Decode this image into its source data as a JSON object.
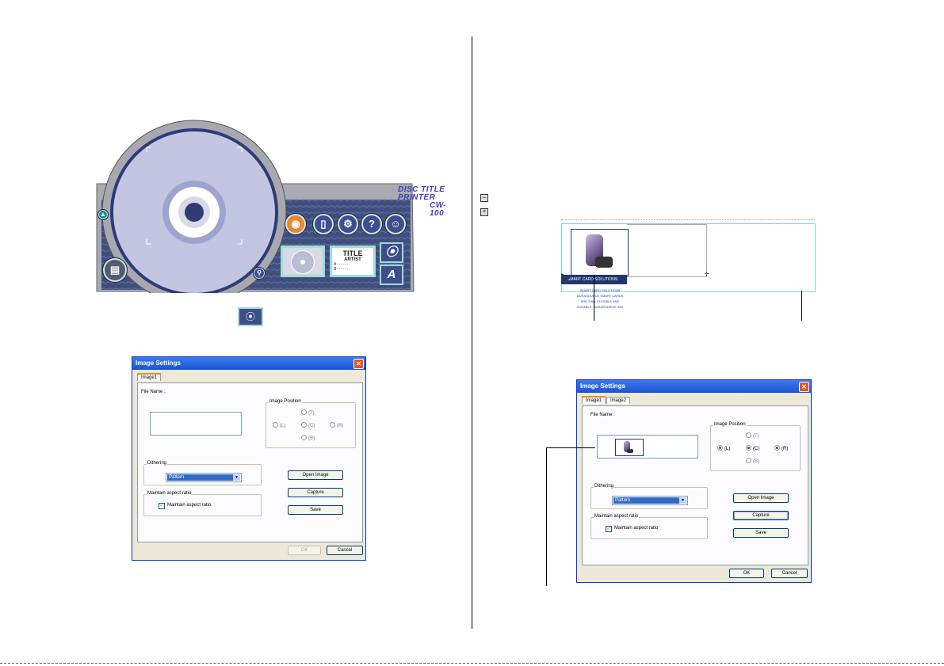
{
  "app": {
    "title_line1": "DISC TITLE PRINTER",
    "title_line2": "CW-100",
    "label_card": {
      "title": "TITLE",
      "artist": "ARTIST",
      "line_a": "A··········",
      "line_b": "B·········"
    },
    "font_button": "A"
  },
  "dialog_small": {
    "title": "Image Settings",
    "tabs": [
      "Image1"
    ],
    "file_name_label": "File Name :",
    "image_position_label": "Image Position",
    "pos_top": "(T)",
    "pos_left": "(L)",
    "pos_center": "(C)",
    "pos_right": "(R)",
    "pos_bottom": "(B)",
    "dithering_label": "Dithering",
    "dithering_value": "Pattern",
    "aspect_group_label": "Maintain aspect ratio",
    "aspect_checkbox_label": "Maintain aspect ratio",
    "open_image": "Open Image",
    "capture": "Capture",
    "save": "Save",
    "ok": "OK",
    "cancel": "Cancel"
  },
  "dialog_large": {
    "title": "Image Settings",
    "tabs": [
      "Image1",
      "Image2"
    ],
    "file_name_label": "File Name :",
    "image_position_label": "Image Position",
    "pos_top": "(T)",
    "pos_left": "(L)",
    "pos_center": "(C)",
    "pos_right": "(R)",
    "pos_bottom": "(B)",
    "dithering_label": "Dithering",
    "dithering_value": "Pattern",
    "aspect_group_label": "Maintain aspect ratio",
    "aspect_checkbox_label": "Maintain aspect ratio",
    "open_image": "Open Image",
    "capture": "Capture",
    "save": "Save",
    "ok": "OK",
    "cancel": "Cancel"
  },
  "layout_preview": {
    "band_text": "SMART CARD SOLUTIONS",
    "caption_1": "SMART CARD SOLUTIONS",
    "caption_2": "DURASOURCE SMART CARDS",
    "caption_3": "ARE THIN, FLEXIBLE AND",
    "caption_4": "DURABLE. DURASOURCE HAS"
  }
}
